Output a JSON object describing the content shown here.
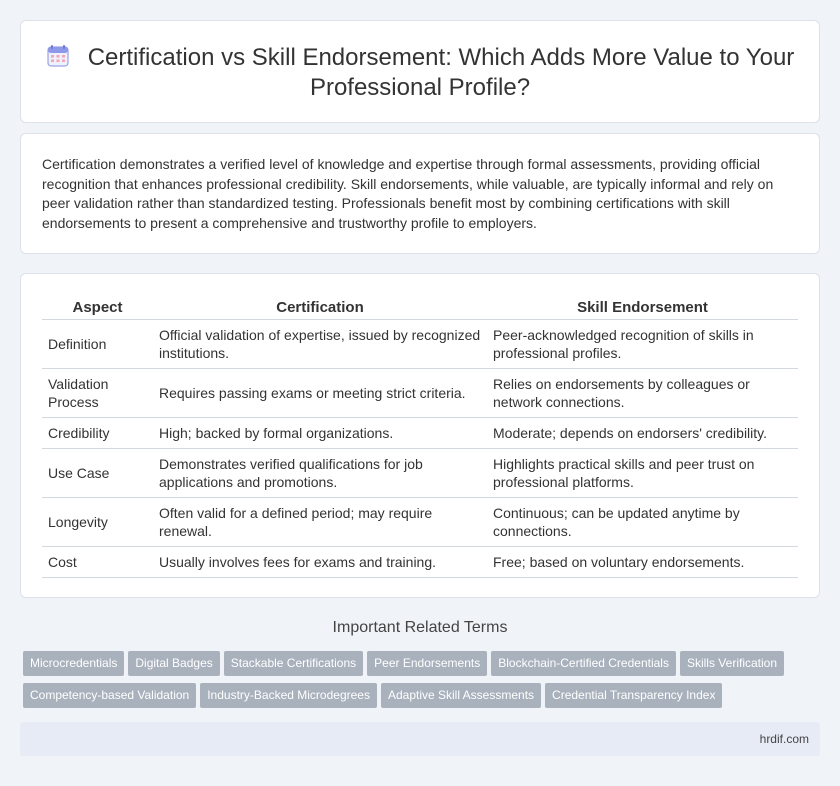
{
  "header": {
    "icon": "calendar-icon",
    "title": "Certification vs Skill Endorsement: Which Adds More Value to Your Professional Profile?"
  },
  "intro": {
    "text": "Certification demonstrates a verified level of knowledge and expertise through formal assessments, providing official recognition that enhances professional credibility. Skill endorsements, while valuable, are typically informal and rely on peer validation rather than standardized testing. Professionals benefit most by combining certifications with skill endorsements to present a comprehensive and trustworthy profile to employers."
  },
  "table": {
    "headers": [
      "Aspect",
      "Certification",
      "Skill Endorsement"
    ],
    "rows": [
      [
        "Definition",
        "Official validation of expertise, issued by recognized institutions.",
        "Peer-acknowledged recognition of skills in professional profiles."
      ],
      [
        "Validation Process",
        "Requires passing exams or meeting strict criteria.",
        "Relies on endorsements by colleagues or network connections."
      ],
      [
        "Credibility",
        "High; backed by formal organizations.",
        "Moderate; depends on endorsers' credibility."
      ],
      [
        "Use Case",
        "Demonstrates verified qualifications for job applications and promotions.",
        "Highlights practical skills and peer trust on professional platforms."
      ],
      [
        "Longevity",
        "Often valid for a defined period; may require renewal.",
        "Continuous; can be updated anytime by connections."
      ],
      [
        "Cost",
        "Usually involves fees for exams and training.",
        "Free; based on voluntary endorsements."
      ]
    ]
  },
  "related": {
    "title": "Important Related Terms",
    "tags": [
      "Microcredentials",
      "Digital Badges",
      "Stackable Certifications",
      "Peer Endorsements",
      "Blockchain-Certified Credentials",
      "Skills Verification",
      "Competency-based Validation",
      "Industry-Backed Microdegrees",
      "Adaptive Skill Assessments",
      "Credential Transparency Index"
    ]
  },
  "footer": {
    "site": "hrdif.com"
  }
}
